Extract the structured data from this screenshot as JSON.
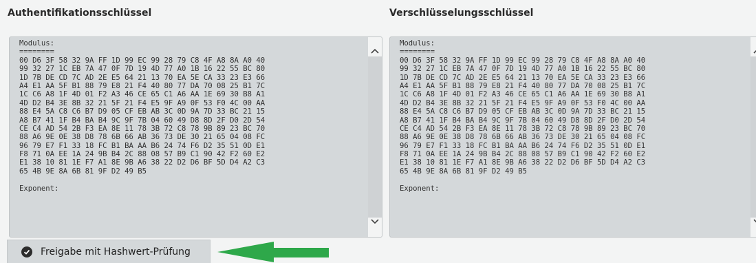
{
  "auth": {
    "title": "Authentifikationsschlüssel",
    "lines": [
      "Modulus:",
      "========",
      "00 D6 3F 58 32 9A FF 1D 99 EC 99 28 79 C8 4F A8 8A A0 40",
      "99 32 27 1C EB 7A 47 0F 7D 19 4D 77 A0 1B 16 22 55 BC 80",
      "1D 7B DE CD 7C AD 2E E5 64 21 13 70 EA 5E CA 33 23 E3 66",
      "A4 E1 AA 5F B1 88 79 E8 21 F4 40 80 77 DA 70 08 25 B1 7C",
      "1C C6 A8 1F 4D 01 F2 A3 46 CE 65 C1 A6 AA 1E 69 30 B8 A1",
      "4D D2 B4 3E 8B 32 21 5F 21 F4 E5 9F A9 0F 53 F0 4C 00 AA",
      "88 E4 5A C8 C6 B7 D9 05 CF EB AB 3C 0D 9A 7D 33 BC 21 15",
      "A8 B7 41 1F B4 BA B4 9C 9F 7B 04 60 49 D8 8D 2F D0 2D 54",
      "CE C4 AD 54 2B F3 EA 8E 11 78 3B 72 C8 78 9B 89 23 BC 70",
      "88 A6 9E 0E 38 D8 78 6B 66 AB 36 73 DE 30 21 65 04 08 FC",
      "96 79 E7 F1 33 18 FC B1 BA AA B6 24 74 F6 D2 35 51 0D E1",
      "F8 71 0A EE 1A 24 9B B4 2C 88 08 57 B9 C1 90 42 F2 60 E2",
      "E1 38 10 81 1E F7 A1 8E 9B A6 38 22 D2 D6 BF 5D D4 A2 C3",
      "65 4B 9E 8A 6B 81 9F D2 49 B5",
      "",
      "Exponent:"
    ]
  },
  "enc": {
    "title": "Verschlüsselungsschlüssel",
    "lines": [
      "Modulus:",
      "========",
      "00 D6 3F 58 32 9A FF 1D 99 EC 99 28 79 C8 4F A8 8A A0 40",
      "99 32 27 1C EB 7A 47 0F 7D 19 4D 77 A0 1B 16 22 55 BC 80",
      "1D 7B DE CD 7C AD 2E E5 64 21 13 70 EA 5E CA 33 23 E3 66",
      "A4 E1 AA 5F B1 88 79 E8 21 F4 40 80 77 DA 70 08 25 B1 7C",
      "1C C6 A8 1F 4D 01 F2 A3 46 CE 65 C1 A6 AA 1E 69 30 B8 A1",
      "4D D2 B4 3E 8B 32 21 5F 21 F4 E5 9F A9 0F 53 F0 4C 00 AA",
      "88 E4 5A C8 C6 B7 D9 05 CF EB AB 3C 0D 9A 7D 33 BC 21 15",
      "A8 B7 41 1F B4 BA B4 9C 9F 7B 04 60 49 D8 8D 2F D0 2D 54",
      "CE C4 AD 54 2B F3 EA 8E 11 78 3B 72 C8 78 9B 89 23 BC 70",
      "88 A6 9E 0E 38 D8 78 6B 66 AB 36 73 DE 30 21 65 04 08 FC",
      "96 79 E7 F1 33 18 FC B1 BA AA B6 24 74 F6 D2 35 51 0D E1",
      "F8 71 0A EE 1A 24 9B B4 2C 88 08 57 B9 C1 90 42 F2 60 E2",
      "E1 38 10 81 1E F7 A1 8E 9B A6 38 22 D2 D6 BF 5D D4 A2 C3",
      "65 4B 9E 8A 6B 81 9F D2 49 B5",
      "",
      "Exponent:"
    ]
  },
  "release_button": {
    "label": "Freigabe mit Hashwert-Prüfung",
    "icon": "check-circle-icon"
  },
  "colors": {
    "arrow": "#2ea84a",
    "panel": "#d4d8da",
    "background": "#f3f4f4"
  }
}
